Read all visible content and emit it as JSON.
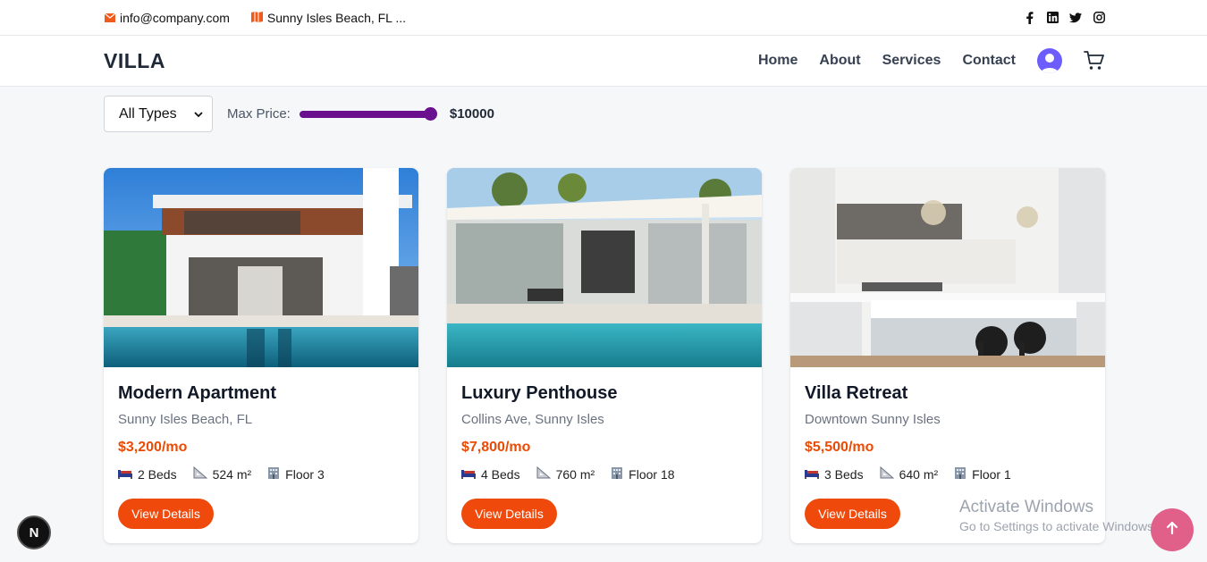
{
  "topbar": {
    "email": "info@company.com",
    "location": "Sunny Isles Beach, FL ...",
    "socials": [
      "facebook-icon",
      "linkedin-icon",
      "twitter-icon",
      "instagram-icon"
    ]
  },
  "navbar": {
    "logo": "VILLA",
    "links": [
      "Home",
      "About",
      "Services",
      "Contact"
    ]
  },
  "filters": {
    "type_selected": "All Types",
    "max_price_label": "Max Price:",
    "max_price_value": "$10000",
    "slider_fraction": 1.0
  },
  "listings": [
    {
      "title": "Modern Apartment",
      "location": "Sunny Isles Beach, FL",
      "price": "$3,200/mo",
      "beds": "2 Beds",
      "area": "524 m²",
      "floor": "Floor 3",
      "button": "View Details"
    },
    {
      "title": "Luxury Penthouse",
      "location": "Collins Ave, Sunny Isles",
      "price": "$7,800/mo",
      "beds": "4 Beds",
      "area": "760 m²",
      "floor": "Floor 18",
      "button": "View Details"
    },
    {
      "title": "Villa Retreat",
      "location": "Downtown Sunny Isles",
      "price": "$5,500/mo",
      "beds": "3 Beds",
      "area": "640 m²",
      "floor": "Floor 1",
      "button": "View Details"
    }
  ],
  "overlay": {
    "n_badge": "N",
    "watermark_title": "Activate Windows",
    "watermark_sub": "Go to Settings to activate Windows."
  },
  "colors": {
    "accent": "#ef4a0c",
    "price": "#ea4b06",
    "slider": "#6a0f8e",
    "scroll_top": "#e0608a"
  }
}
